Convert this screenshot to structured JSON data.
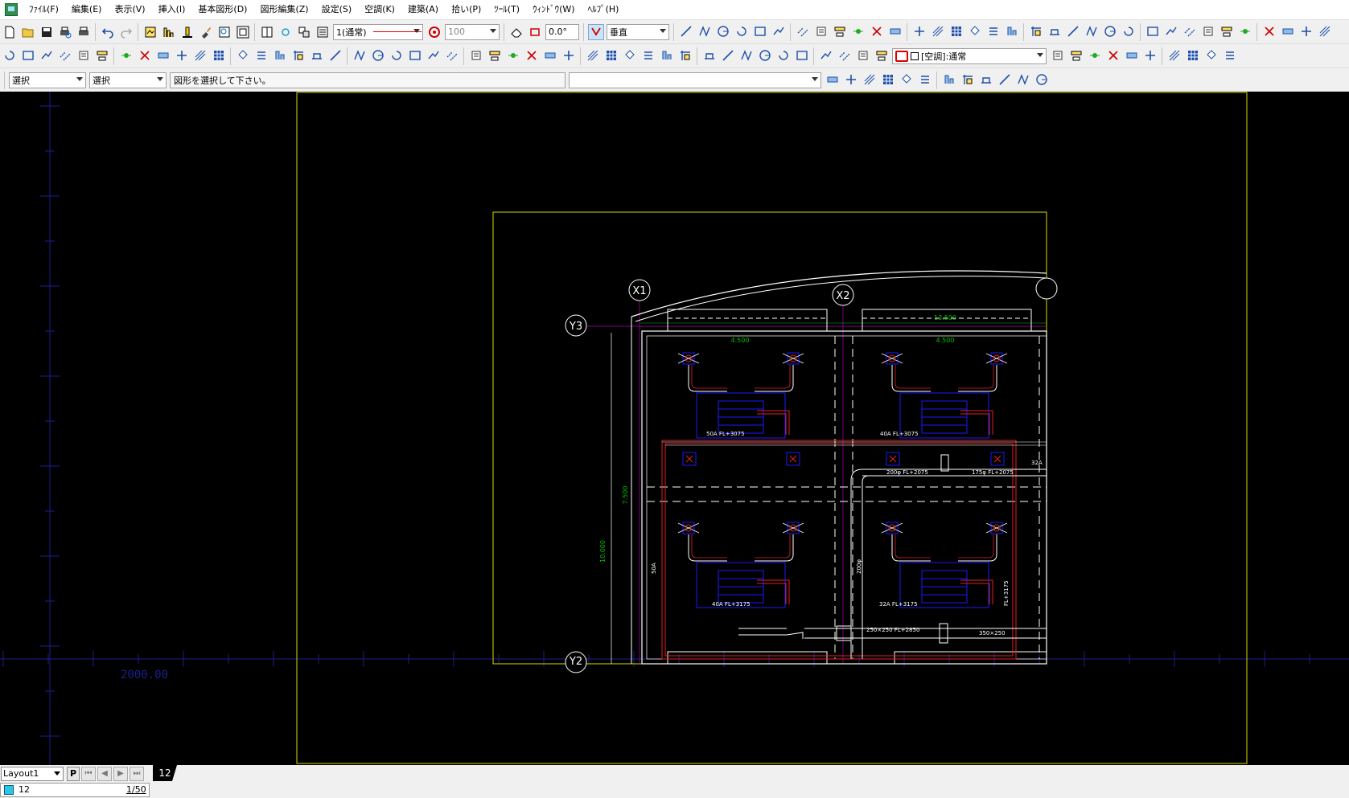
{
  "menu": [
    "ﾌｧｲﾙ(F)",
    "編集(E)",
    "表示(V)",
    "挿入(I)",
    "基本図形(D)",
    "図形編集(Z)",
    "設定(S)",
    "空調(K)",
    "建築(A)",
    "拾い(P)",
    "ﾂｰﾙ(T)",
    "ｳｨﾝﾄﾞｳ(W)",
    "ﾍﾙﾌﾟ(H)"
  ],
  "toolbar1": {
    "linestyle_value": "1(通常)",
    "linestyle_color": "#e00000",
    "scale_value": "100",
    "angle_value": "0.0°",
    "direction_value": "垂直"
  },
  "toolbar2": {
    "layer_combo_value": "[空調]:通常"
  },
  "toolbar3": {
    "select_mode_1": "選択",
    "select_mode_2": "選択",
    "prompt": "図形を選択して下さい。",
    "command_input": ""
  },
  "drawing": {
    "axis_labels": [
      "X1",
      "X2",
      "Y3",
      "Y2"
    ],
    "dimensions": [
      "13.500",
      "4.500",
      "4.500",
      "7.500",
      "10.000"
    ],
    "pipe_labels": [
      "50A FL+3075",
      "40A FL+3075",
      "50A",
      "32A",
      "200φ FL+2075",
      "175φ FL+2075",
      "50A FL+3075",
      "40A FL+3175",
      "32A FL+3175",
      "250×250 FL+2850",
      "350×250",
      "200φ",
      "FL+3175"
    ],
    "grid_coordinate": "2000.00",
    "colors": {
      "background": "#000000",
      "frame": "#d8d800",
      "wall": "#ffffff",
      "pipe": "#e02020",
      "duct": "#ffffff",
      "equipment": "#1a1aff",
      "grid_axis": "#1e1e8c",
      "dimension": "#00c000"
    }
  },
  "bottom": {
    "layout_tab": "Layout1",
    "paper_button": "P",
    "sheet_tab": "12",
    "layer_name": "12",
    "scale": "1/50"
  }
}
